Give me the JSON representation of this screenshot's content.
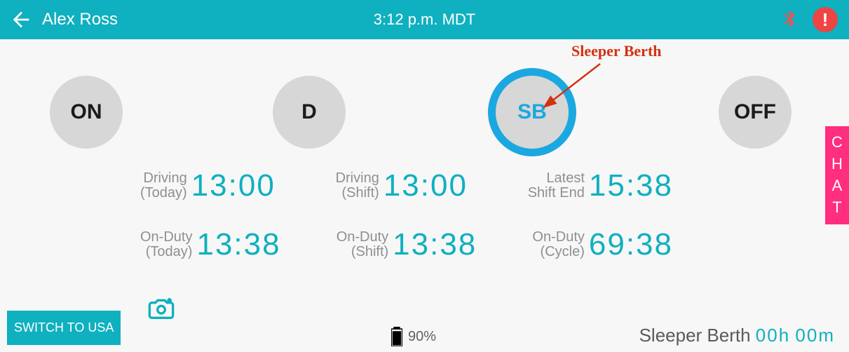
{
  "header": {
    "driver_name": "Alex Ross",
    "time_display": "3:12 p.m. MDT"
  },
  "status_buttons": {
    "on": {
      "label": "ON",
      "selected": false
    },
    "d": {
      "label": "D",
      "selected": false
    },
    "sb": {
      "label": "SB",
      "selected": true
    },
    "off": {
      "label": "OFF",
      "selected": false
    }
  },
  "annotation": {
    "text": "Sleeper Berth"
  },
  "metrics": {
    "driving_today": {
      "label_line1": "Driving",
      "label_line2": "(Today)",
      "value": "13:00"
    },
    "driving_shift": {
      "label_line1": "Driving",
      "label_line2": "(Shift)",
      "value": "13:00"
    },
    "latest_shift_end": {
      "label_line1": "Latest",
      "label_line2": "Shift End",
      "value": "15:38"
    },
    "onduty_today": {
      "label_line1": "On-Duty",
      "label_line2": "(Today)",
      "value": "13:38"
    },
    "onduty_shift": {
      "label_line1": "On-Duty",
      "label_line2": "(Shift)",
      "value": "13:38"
    },
    "onduty_cycle": {
      "label_line1": "On-Duty",
      "label_line2": "(Cycle)",
      "value": "69:38"
    }
  },
  "bottom": {
    "switch_label": "SWITCH TO USA",
    "battery_pct": "90%",
    "summary_label": "Sleeper Berth",
    "summary_hours": "00h",
    "summary_minutes": "00m"
  },
  "chat_tab": {
    "c": "C",
    "h": "H",
    "a": "A",
    "t": "T"
  },
  "colors": {
    "brand_teal": "#0fb0bf",
    "accent_blue": "#1ba8e0",
    "alert_red": "#ef4444",
    "chat_pink": "#ff2e7e",
    "annotation_red": "#d13212"
  }
}
